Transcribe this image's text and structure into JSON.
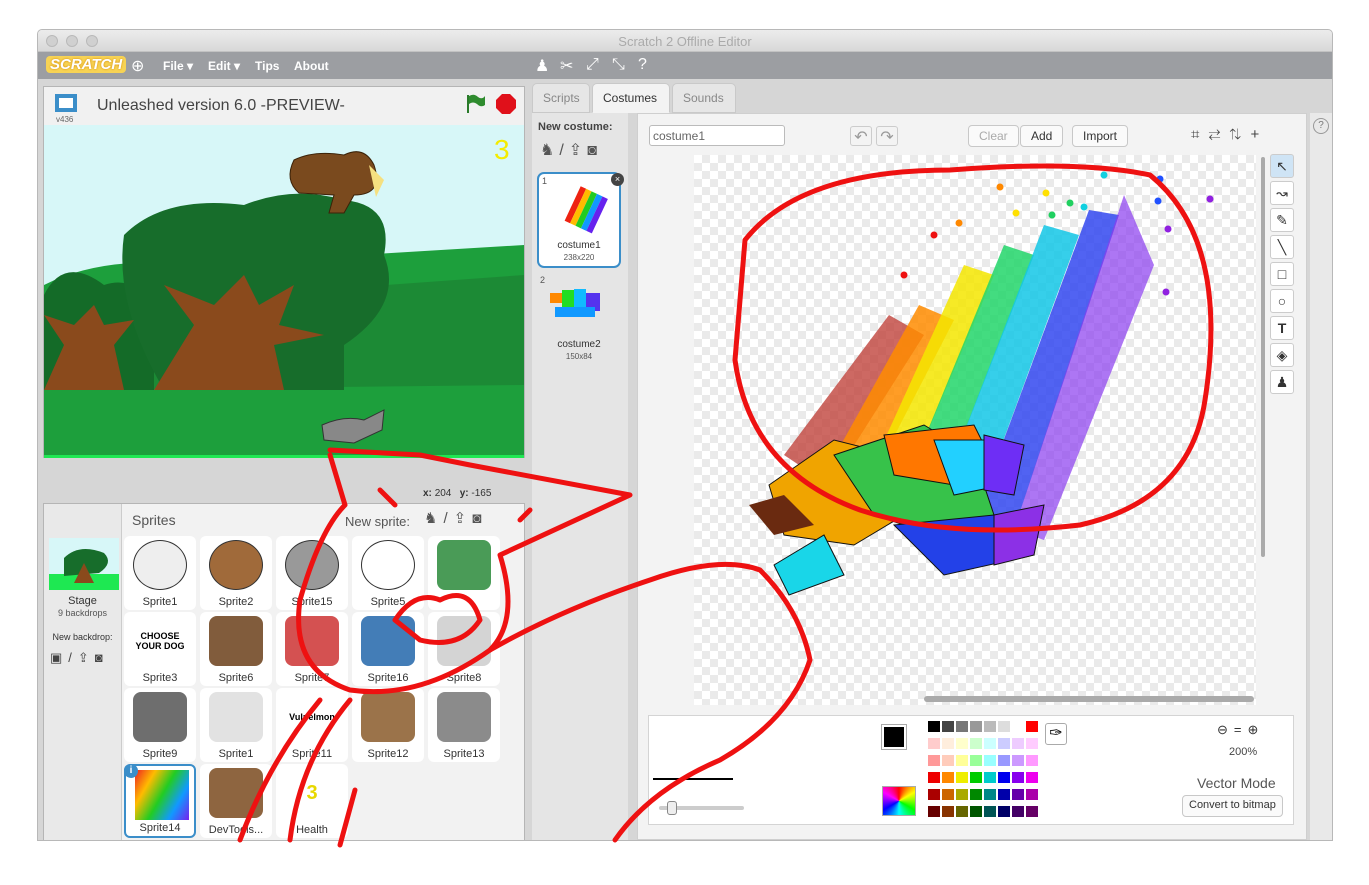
{
  "window": {
    "title": "Scratch 2 Offline Editor"
  },
  "menu": {
    "logo": "SCRATCH",
    "file": "File ▾",
    "edit": "Edit ▾",
    "tips": "Tips",
    "about": "About"
  },
  "stage": {
    "project_title": "Unleashed version 6.0 -PREVIEW-",
    "version": "v436",
    "counter": "3",
    "x_label": "x:",
    "x_value": "204",
    "y_label": "y:",
    "y_value": "-165"
  },
  "sprites": {
    "header": "Sprites",
    "new_sprite": "New sprite:",
    "stage_label": "Stage",
    "stage_sub": "9 backdrops",
    "new_backdrop": "New backdrop:",
    "items": [
      {
        "name": "Sprite1"
      },
      {
        "name": "Sprite2"
      },
      {
        "name": "Sprite15"
      },
      {
        "name": "Sprite5"
      },
      {
        "name": ""
      },
      {
        "name": "Sprite3",
        "img_text": "CHOOSE YOUR DOG"
      },
      {
        "name": "Sprite6"
      },
      {
        "name": "Sprite7"
      },
      {
        "name": "Sprite16"
      },
      {
        "name": "Sprite8"
      },
      {
        "name": "Sprite9"
      },
      {
        "name": "Sprite1"
      },
      {
        "name": "Sprite11",
        "img_text": "Vulpelmon"
      },
      {
        "name": "Sprite12"
      },
      {
        "name": "Sprite13"
      },
      {
        "name": "Sprite14"
      },
      {
        "name": "DevTools..."
      },
      {
        "name": "Health",
        "img_text": "3"
      }
    ]
  },
  "tabs": {
    "scripts": "Scripts",
    "costumes": "Costumes",
    "sounds": "Sounds"
  },
  "costumes": {
    "header": "New costume:",
    "items": [
      {
        "index": "1",
        "name": "costume1",
        "size": "238x220"
      },
      {
        "index": "2",
        "name": "costume2",
        "size": "150x84"
      }
    ]
  },
  "editor": {
    "costume_name": "costume1",
    "clear": "Clear",
    "add": "Add",
    "import": "Import",
    "zoom": "200%",
    "mode": "Vector Mode",
    "convert": "Convert to bitmap"
  },
  "colors": {
    "accent": "#3b8ec9",
    "menubar": "#9c9ea2",
    "scribble": "#ee1111"
  },
  "help": "?"
}
